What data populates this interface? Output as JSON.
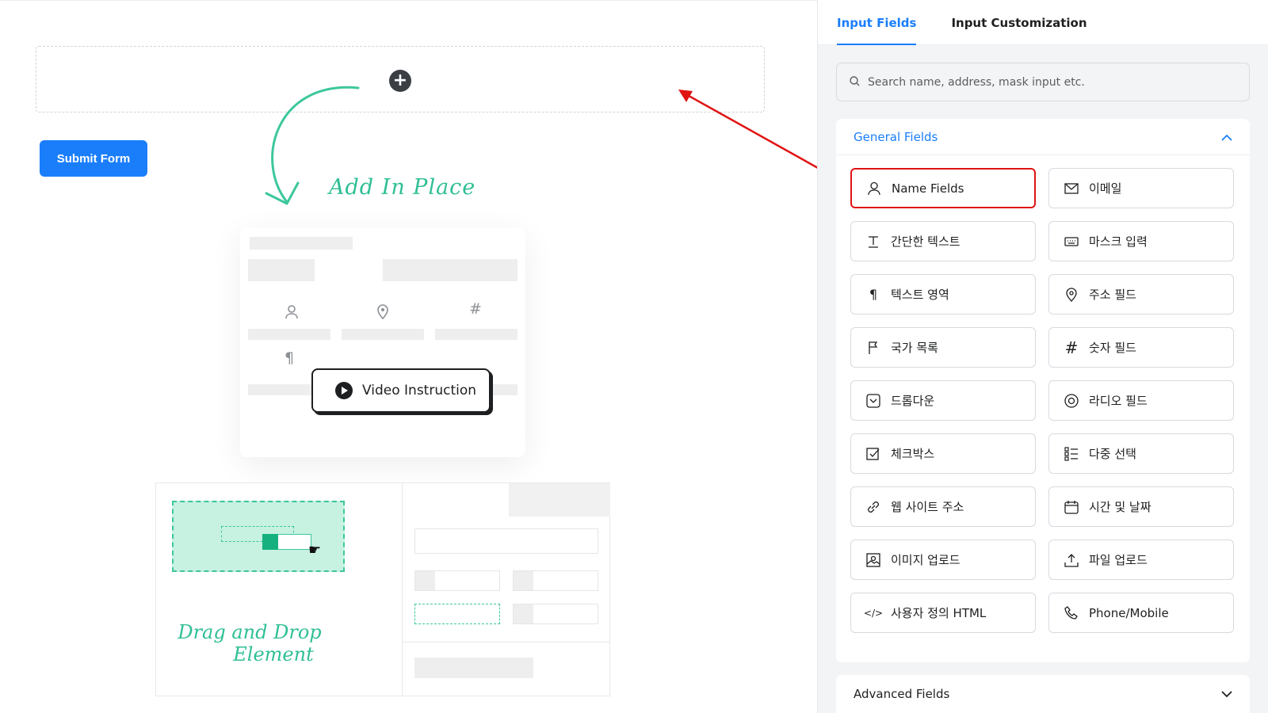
{
  "canvas": {
    "add_in_place": "Add In Place",
    "video_instruction": "Video Instruction",
    "drag_and_drop_line1": "Drag and Drop",
    "drag_and_drop_line2": "Element",
    "submit_label": "Submit Form",
    "add_icon": "plus-icon"
  },
  "panel": {
    "tabs": [
      {
        "label": "Input Fields",
        "active": true
      },
      {
        "label": "Input Customization",
        "active": false
      }
    ],
    "search": {
      "placeholder": "Search name, address, mask input etc.",
      "value": ""
    },
    "general": {
      "title": "General Fields",
      "fields": [
        {
          "label": "Name Fields",
          "icon": "user-icon"
        },
        {
          "label": "이메일",
          "icon": "envelope-icon"
        },
        {
          "label": "간단한 텍스트",
          "icon": "text-input-icon"
        },
        {
          "label": "마스크 입력",
          "icon": "keyboard-icon"
        },
        {
          "label": "텍스트 영역",
          "icon": "paragraph-icon"
        },
        {
          "label": "주소 필드",
          "icon": "map-pin-icon"
        },
        {
          "label": "국가 목록",
          "icon": "flag-icon"
        },
        {
          "label": "숫자 필드",
          "icon": "hash-icon"
        },
        {
          "label": "드롭다운",
          "icon": "dropdown-icon"
        },
        {
          "label": "라디오 필드",
          "icon": "radio-icon"
        },
        {
          "label": "체크박스",
          "icon": "checkbox-icon"
        },
        {
          "label": "다중 선택",
          "icon": "list-icon"
        },
        {
          "label": "웹 사이트 주소",
          "icon": "link-icon"
        },
        {
          "label": "시간 및 날짜",
          "icon": "calendar-icon"
        },
        {
          "label": "이미지 업로드",
          "icon": "image-icon"
        },
        {
          "label": "파일 업로드",
          "icon": "upload-icon"
        },
        {
          "label": "사용자 정의 HTML",
          "icon": "code-icon"
        },
        {
          "label": "Phone/Mobile",
          "icon": "phone-icon"
        }
      ]
    },
    "advanced": {
      "title": "Advanced Fields"
    }
  },
  "colors": {
    "accent": "#1a7efb",
    "highlight": "#e01313",
    "script_green": "#2fbf95"
  }
}
